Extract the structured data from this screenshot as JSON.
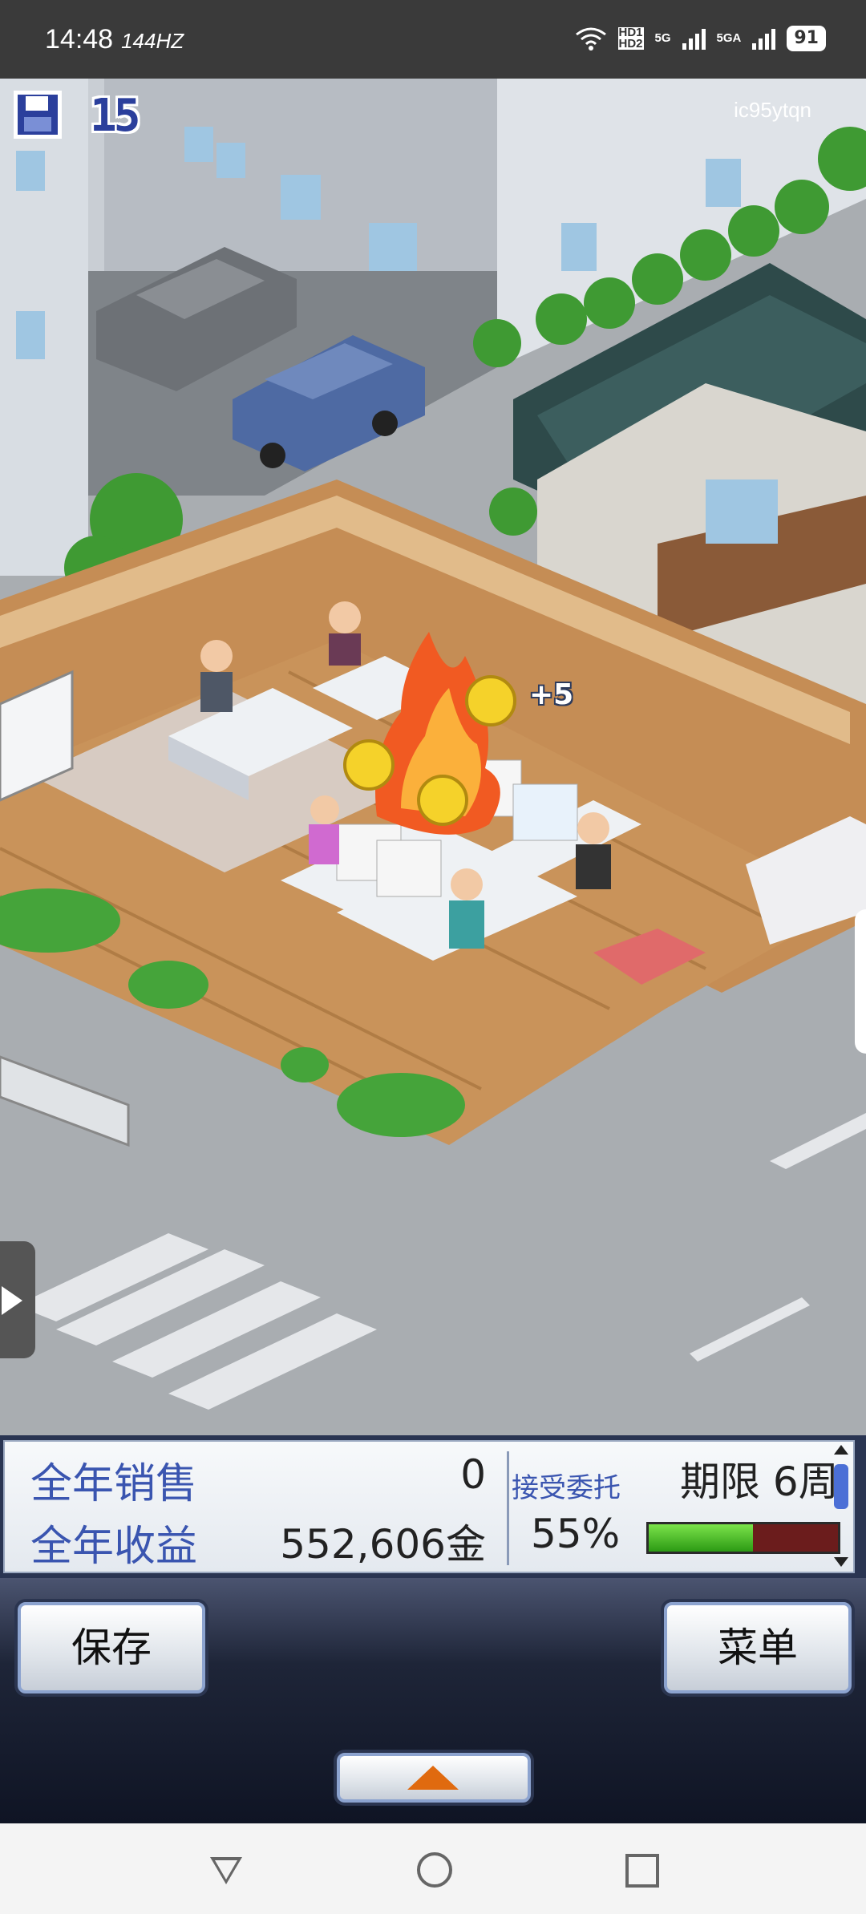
{
  "status_bar": {
    "time": "14:48",
    "refresh_rate": "144HZ",
    "network_badges": [
      "HD1 HD2",
      "5G",
      "5GA"
    ],
    "battery": "91"
  },
  "game": {
    "save_days": "15",
    "watermark": "ic95ytqn",
    "bonus_popup": "+5"
  },
  "stats_panel": {
    "annual_sales_label": "全年销售",
    "annual_sales_value": "0",
    "annual_profit_label": "全年收益",
    "annual_profit_value": "552,606金",
    "contract_label": "接受委托",
    "deadline_text": "期限 6周",
    "progress_text": "55%",
    "progress_value": 0.55
  },
  "buttons": {
    "save_label": "保存",
    "menu_label": "菜单"
  },
  "colors": {
    "label_blue": "#3a55b0",
    "progress_green": "#4cc22a",
    "progress_empty": "#6b1c1c",
    "up_arrow_orange": "#e06a0f"
  }
}
